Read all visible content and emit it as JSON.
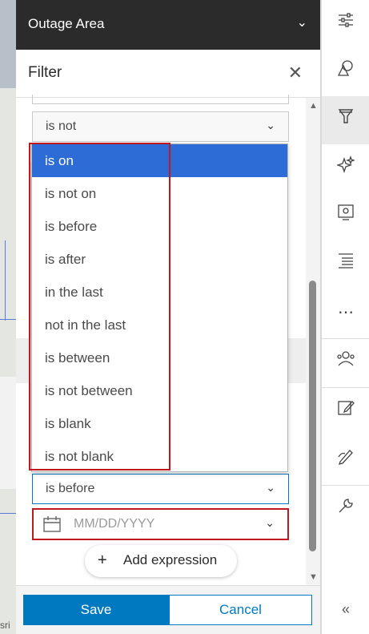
{
  "header": {
    "title": "Outage Area",
    "chevron_icon": "chevron-down-icon"
  },
  "filter": {
    "title": "Filter",
    "close_icon": "close-icon"
  },
  "conditions": {
    "operator_top": "is not",
    "operator_bottom": "is before",
    "date_placeholder": "MM/DD/YYYY"
  },
  "dropdown": {
    "options": [
      "is on",
      "is not on",
      "is before",
      "is after",
      "in the last",
      "not in the last",
      "is between",
      "is not between",
      "is blank",
      "is not blank"
    ],
    "selected": "is on"
  },
  "add_expression": {
    "label": "Add expression"
  },
  "footer": {
    "save": "Save",
    "cancel": "Cancel"
  },
  "map": {
    "attribution": "sri"
  },
  "colors": {
    "accent": "#0079c1",
    "highlight": "#c0191d",
    "selected": "#2d6bd6"
  },
  "toolbar": {
    "icons": [
      "sliders-icon",
      "shapes-icon",
      "filter-icon",
      "sparkle-icon",
      "settings-icon",
      "list-icon",
      "more-icon",
      "people-icon",
      "edit-icon",
      "sketch-icon",
      "wrench-icon",
      "collapse-icon"
    ]
  }
}
